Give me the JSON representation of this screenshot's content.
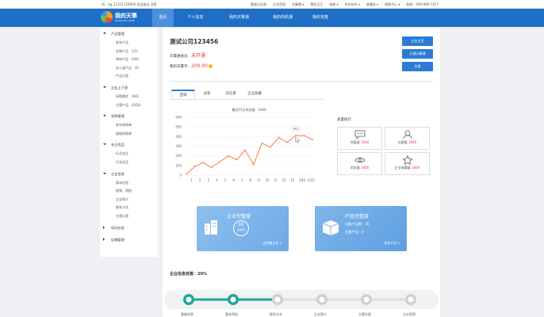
{
  "topbar": {
    "greeting": "Hi，hg_13311116600  欢迎退出 消息",
    "links": [
      "客服与反馈",
      "企业官网",
      "天擎通 ▾",
      "我的汉王",
      "电商 ▾",
      "合作伙伴 ▾",
      "收藏夹 ▾",
      "帮助中心 ▾",
      "热线：400-990-7317"
    ]
  },
  "logo": {
    "name": "我的天擎",
    "sub": "QYWOSS.COM"
  },
  "nav": {
    "tabs": [
      "首页",
      "个人信息",
      "我的天擎通",
      "我的商机通",
      "我的克隆"
    ],
    "active_index": 0
  },
  "sidebar": {
    "groups": [
      {
        "label": "产品管理",
        "expanded": true,
        "items": [
          "发布产品",
          "在售产品 （12）",
          "审核产品 （0/6）",
          "未上架产品 （6）",
          "产品分类"
        ]
      },
      {
        "label": "企业上下游",
        "expanded": true,
        "items": [
          "采购需求 （0/6）",
          "主营产品 （0/20）"
        ]
      },
      {
        "label": "采购管理",
        "expanded": true,
        "items": [
          "发布采购单",
          "管理采购单"
        ]
      },
      {
        "label": "名企优品",
        "expanded": true,
        "items": [
          "行业名企",
          "行业优品"
        ]
      },
      {
        "label": "企业信息",
        "expanded": true,
        "items": [
          "基本信息",
          "视频、相册",
          "企业简介",
          "联系方式",
          "主营分类"
        ]
      },
      {
        "label": "QQ/在线",
        "expanded": false,
        "items": []
      },
      {
        "label": "店铺管理",
        "expanded": false,
        "items": []
      }
    ]
  },
  "header": {
    "company": "测试公司123456",
    "status_label": "天擎通会员：",
    "status_value": "未开通",
    "coin_label": "我的天擎币：",
    "coin_value": "200.00",
    "buttons": [
      "企业主页",
      "开通天擎通",
      "充值"
    ]
  },
  "tabs": {
    "items": [
      "咨询",
      "访客",
      "浏览量",
      "企业收藏"
    ],
    "active_index": 0
  },
  "chart_data": {
    "type": "line",
    "title": "最近15天浏览量：1600",
    "categories": [
      "1",
      "2",
      "3",
      "4",
      "5",
      "6",
      "7",
      "8",
      "9",
      "10",
      "11",
      "12",
      "13",
      "14",
      "15（0月）"
    ],
    "values": [
      10,
      90,
      130,
      80,
      140,
      200,
      160,
      260,
      110,
      330,
      290,
      390,
      340,
      410,
      410,
      370
    ],
    "x": [
      0,
      1,
      2,
      3,
      4,
      5,
      6,
      7,
      8,
      9,
      10,
      11,
      12,
      13,
      14,
      15
    ],
    "y_ticks": [
      0,
      100,
      200,
      300,
      400,
      500,
      600
    ],
    "ylim": [
      0,
      600
    ],
    "tooltip": "410",
    "color": "#ff7a45"
  },
  "stats": {
    "title": "总量统计",
    "items": [
      {
        "icon": "chat-icon",
        "label": "询盘量",
        "value": "1600"
      },
      {
        "icon": "user-icon",
        "label": "访客量",
        "value": "1600"
      },
      {
        "icon": "eye-icon",
        "label": "浏览量",
        "value": "1600"
      },
      {
        "icon": "star-icon",
        "label": "企业收藏量",
        "value": "1600"
      }
    ]
  },
  "cards": [
    {
      "title": "企业完整度",
      "score": "92",
      "score_label": "当前得分",
      "link": "去完善企业 >",
      "color": "#8dc0ef"
    },
    {
      "title": "产品完整度",
      "line1": "当前产品数：30",
      "line2": "五星产品：0",
      "link": "发布产品 >",
      "color": "#7fb5ea"
    }
  ],
  "progress": {
    "title": "企业信息完善：20%",
    "steps": [
      "基础信息",
      "基本资料",
      "联系方式",
      "企业简介",
      "主营分类",
      "企业官网"
    ],
    "done": 2
  }
}
